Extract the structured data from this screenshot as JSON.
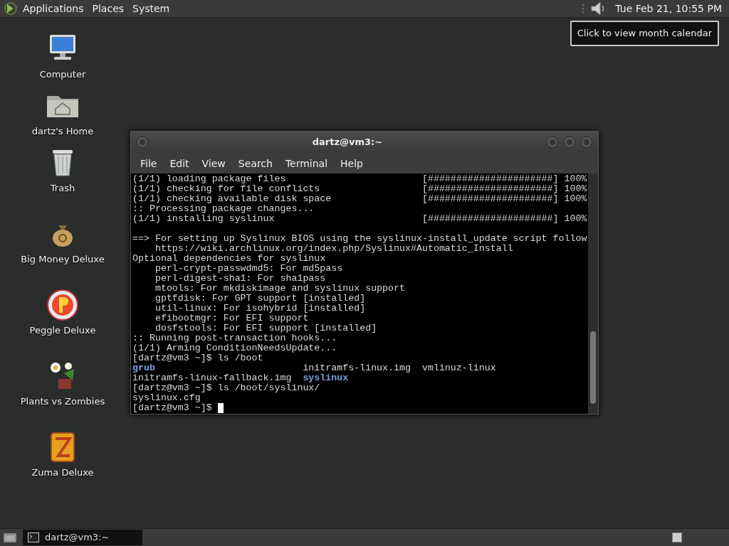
{
  "top_panel": {
    "menus": [
      "Applications",
      "Places",
      "System"
    ],
    "clock": "Tue Feb 21, 10:55 PM",
    "tooltip": "Click to view month calendar"
  },
  "desktop_icons": [
    {
      "label": "Computer",
      "kind": "computer"
    },
    {
      "label": "dartz's Home",
      "kind": "home"
    },
    {
      "label": "Trash",
      "kind": "trash"
    },
    {
      "label": "Big Money Deluxe",
      "kind": "moneybag"
    },
    {
      "label": "Peggle Deluxe",
      "kind": "ball"
    },
    {
      "label": "Plants vs Zombies",
      "kind": "flower"
    },
    {
      "label": "Zuma Deluxe",
      "kind": "block"
    }
  ],
  "terminal": {
    "title": "dartz@vm3:~",
    "menu": [
      "File",
      "Edit",
      "View",
      "Search",
      "Terminal",
      "Help"
    ],
    "lines": [
      [
        {
          "text": "(1/1) loading package files                        [######################] 100%",
          "kind": "plain"
        }
      ],
      [
        {
          "text": "(1/1) checking for file conflicts                  [######################] 100%",
          "kind": "plain"
        }
      ],
      [
        {
          "text": "(1/1) checking available disk space                [######################] 100%",
          "kind": "plain"
        }
      ],
      [
        {
          "text": ":: Processing package changes...",
          "kind": "plain"
        }
      ],
      [
        {
          "text": "(1/1) installing syslinux                          [######################] 100%",
          "kind": "plain"
        }
      ],
      [
        {
          "kind": "blank"
        }
      ],
      [
        {
          "text": "==> For setting up Syslinux BIOS using the syslinux-install_update script follow",
          "kind": "plain"
        }
      ],
      [
        {
          "text": "    https://wiki.archlinux.org/index.php/Syslinux#Automatic_Install",
          "kind": "plain"
        }
      ],
      [
        {
          "text": "Optional dependencies for syslinux",
          "kind": "plain"
        }
      ],
      [
        {
          "text": "    perl-crypt-passwdmd5: For md5pass",
          "kind": "plain"
        }
      ],
      [
        {
          "text": "    perl-digest-sha1: For sha1pass",
          "kind": "plain"
        }
      ],
      [
        {
          "text": "    mtools: For mkdiskimage and syslinux support",
          "kind": "plain"
        }
      ],
      [
        {
          "text": "    gptfdisk: For GPT support [installed]",
          "kind": "plain"
        }
      ],
      [
        {
          "text": "    util-linux: For isohybrid [installed]",
          "kind": "plain"
        }
      ],
      [
        {
          "text": "    efibootmgr: For EFI support",
          "kind": "plain"
        }
      ],
      [
        {
          "text": "    dosfstools: For EFI support [installed]",
          "kind": "plain"
        }
      ],
      [
        {
          "text": ":: Running post-transaction hooks...",
          "kind": "plain"
        }
      ],
      [
        {
          "text": "(1/1) Arming ConditionNeedsUpdate...",
          "kind": "plain"
        }
      ],
      [
        {
          "text": "[dartz@vm3 ~]$ ls /boot",
          "kind": "plain"
        }
      ],
      [
        {
          "text": "grub",
          "kind": "dir"
        },
        {
          "text": "                          initramfs-linux.img  vmlinuz-linux",
          "kind": "plain"
        }
      ],
      [
        {
          "text": "initramfs-linux-fallback.img  ",
          "kind": "plain"
        },
        {
          "text": "syslinux",
          "kind": "dir"
        }
      ],
      [
        {
          "text": "[dartz@vm3 ~]$ ls /boot/syslinux/",
          "kind": "plain"
        }
      ],
      [
        {
          "text": "syslinux.cfg",
          "kind": "plain"
        }
      ],
      [
        {
          "text": "[dartz@vm3 ~]$ ",
          "kind": "plain"
        }
      ]
    ]
  },
  "taskbar": {
    "tasks": [
      {
        "label": "dartz@vm3:~",
        "selected": true
      }
    ]
  }
}
